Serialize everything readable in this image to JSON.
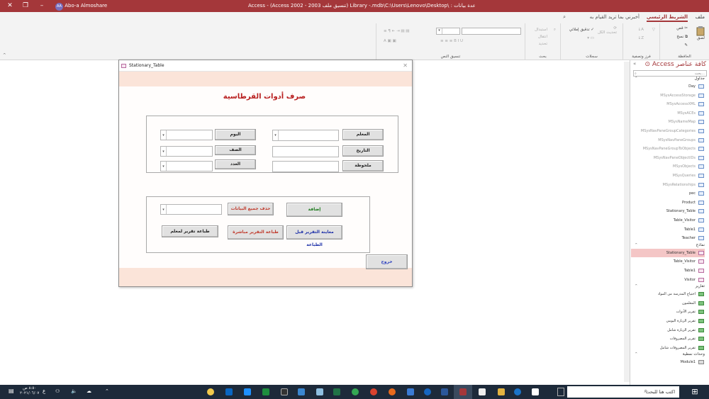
{
  "titlebar": {
    "title": "Access  -  (Access 2002 - 2003 تنسيق ملف) Library -.mdb\\C:\\Users\\Lenovo\\Desktop\\ : قاعدة بيانات - Library",
    "user": "Abo-a Almoshare",
    "initials": "AA",
    "min": "–",
    "max": "❐",
    "close": "✕"
  },
  "ribbon_tabs": {
    "file": "ملف",
    "home": "الشريط الرئيسي",
    "tell": "أخبرني بما تريد القيام به"
  },
  "ribbon": {
    "clipboard": {
      "label": "الحافظة",
      "paste": "لصق",
      "cut": "قص",
      "copy": "نسخ",
      "format": ""
    },
    "sort": {
      "label": "فرز وتصفية"
    },
    "records": {
      "label": "سجلات",
      "refresh": "تحديث الكل",
      "spelling": "تدقيق إملائي",
      "more": ""
    },
    "find": {
      "label": "بحث",
      "find": "بحث",
      "replace": "استبدال",
      "goto": "انتقال"
    },
    "textfmt": {
      "label": "تنسيق النص",
      "select": "تحديد"
    },
    "collapse": "^",
    "search_icon": "⌕"
  },
  "nav": {
    "title": "كافة عناصر Access",
    "search_placeholder": "بحث...",
    "tables_header": "جداول",
    "tables": [
      "Day",
      "MSysAccessStorage",
      "MSysAccessXML",
      "MSysACEs",
      "MSysNameMap",
      "MSysNavPaneGroupCategories",
      "MSysNavPaneGroups",
      "MSysNavPaneGroupToObjects",
      "MSysNavPaneObjectIDs",
      "MSysObjects",
      "MSysQueries",
      "MSysRelationships",
      "pec",
      "Product",
      "Stationary_Table",
      "Table_Visitor",
      "Table1",
      "Teacher"
    ],
    "forms_header": "نماذج",
    "forms": [
      "Stationary_Table",
      "Table_Visitor",
      "Table1",
      "Visitor"
    ],
    "reports_header": "تقارير",
    "reports": [
      "احتياج المدرسة من المواد",
      "المعلمون",
      "تقرير الأدوات",
      "تقرير الزيارة اليومي",
      "تقرير الزيارة شامل",
      "تقرير المصروفات",
      "تقرير المصروفات شامل"
    ],
    "modules_header": "وحدات نمطية",
    "modules": [
      "Module1"
    ]
  },
  "form": {
    "window_title": "Stationary_Table",
    "heading": "صرف أدوات القرطاسية",
    "labels": {
      "teacher": "المعلم",
      "date": "التاريخ",
      "note": "ملحوظة",
      "day": "اليوم",
      "class": "الصف",
      "count": "العدد"
    },
    "buttons": {
      "add": "إضافة",
      "delete_all": "حذف جميع البيانات",
      "preview": "معاينة التقرير قبل الطباعة",
      "print_direct": "طباعة التقرير مباشرة",
      "print_teacher": "طباعة تقرير لمعلم",
      "exit": "خروج"
    },
    "colors": {
      "heading": "#b81e1e",
      "add": "#1b7a1b",
      "delete": "#c0392b",
      "preview": "#1c2fa8",
      "print": "#c0392b",
      "exit": "#2b3fbf"
    }
  },
  "taskbar": {
    "search": "اكتب هنا للبحث",
    "time": "٨:٥٠ ص",
    "date": "٢٠٢١/٠٦/٠٧",
    "lang": "ع"
  }
}
